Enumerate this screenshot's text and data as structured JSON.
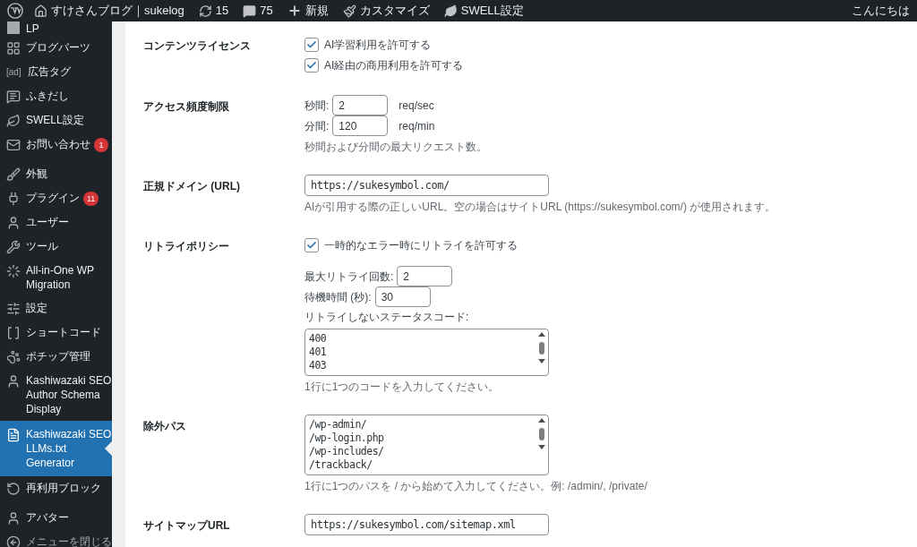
{
  "admin_bar": {
    "site_name": "すけさんブログ｜sukelog",
    "updates": "15",
    "comments": "75",
    "new": "新規",
    "customize": "カスタマイズ",
    "swell": "SWELL設定",
    "greeting": "こんにちは"
  },
  "sidebar": {
    "items": [
      {
        "label": "LP",
        "selected": false
      },
      {
        "label": "ブログパーツ",
        "selected": false
      },
      {
        "label": "広告タグ",
        "icon_text": "[ad]",
        "selected": false
      },
      {
        "label": "ふきだし",
        "selected": false
      },
      {
        "label": "SWELL設定",
        "selected": false
      },
      {
        "label": "お問い合わせ",
        "badge": "1",
        "selected": false
      },
      {
        "label": "外観",
        "separator": true,
        "selected": false
      },
      {
        "label": "プラグイン",
        "badge": "11",
        "selected": false
      },
      {
        "label": "ユーザー",
        "selected": false
      },
      {
        "label": "ツール",
        "selected": false
      },
      {
        "label": "All-in-One WP Migration",
        "selected": false
      },
      {
        "label": "設定",
        "selected": false
      },
      {
        "label": "ショートコード",
        "selected": false
      },
      {
        "label": "ポチップ管理",
        "selected": false
      },
      {
        "label": "Kashiwazaki SEO Author Schema Display",
        "selected": false
      },
      {
        "label": "Kashiwazaki SEO LLMs.txt Generator",
        "selected": true
      },
      {
        "label": "再利用ブロック",
        "selected": false
      },
      {
        "label": "アバター",
        "separator": true,
        "selected": false
      },
      {
        "label": "メニューを閉じる",
        "kind": "collapse",
        "selected": false
      }
    ]
  },
  "settings": [
    {
      "label": "コンテンツライセンス",
      "controls": [
        {
          "kind": "checkbox",
          "label": "AI学習利用を許可する",
          "checked": true
        },
        {
          "kind": "checkbox",
          "label": "AI経由の商用利用を許可する",
          "checked": true
        }
      ]
    },
    {
      "label": "アクセス頻度制限",
      "controls": [
        {
          "kind": "number",
          "label": "秒間:",
          "value": "2",
          "unit": "req/sec"
        },
        {
          "kind": "number",
          "label": "分間:",
          "value": "120",
          "unit": "req/min"
        },
        {
          "kind": "help",
          "text": "秒間および分間の最大リクエスト数。"
        }
      ]
    },
    {
      "label": "正規ドメイン (URL)",
      "controls": [
        {
          "kind": "url",
          "value": "https://sukesymbol.com/"
        },
        {
          "kind": "help",
          "text": "AIが引用する際の正しいURL。空の場合はサイトURL (https://sukesymbol.com/) が使用されます。"
        }
      ]
    },
    {
      "label": "リトライポリシー",
      "controls": [
        {
          "kind": "checkbox",
          "label": "一時的なエラー時にリトライを許可する",
          "checked": true
        },
        {
          "kind": "spacer"
        },
        {
          "kind": "number",
          "label": "最大リトライ回数:",
          "value": "2"
        },
        {
          "kind": "number",
          "label": "待機時間 (秒):",
          "value": "30"
        },
        {
          "kind": "caption",
          "text": "リトライしないステータスコード:"
        },
        {
          "kind": "textarea",
          "lines": [
            "400",
            "401",
            "403"
          ]
        },
        {
          "kind": "help",
          "text": "1行に1つのコードを入力してください。"
        }
      ]
    },
    {
      "label": "除外パス",
      "controls": [
        {
          "kind": "textarea",
          "lines": [
            "/wp-admin/",
            "/wp-login.php",
            "/wp-includes/",
            "/trackback/"
          ]
        },
        {
          "kind": "help",
          "text": "1行に1つのパスを / から始めて入力してください。例: /admin/, /private/"
        }
      ]
    },
    {
      "label": "サイトマップURL",
      "controls": [
        {
          "kind": "url",
          "value": "https://sukesymbol.com/sitemap.xml"
        }
      ]
    }
  ]
}
